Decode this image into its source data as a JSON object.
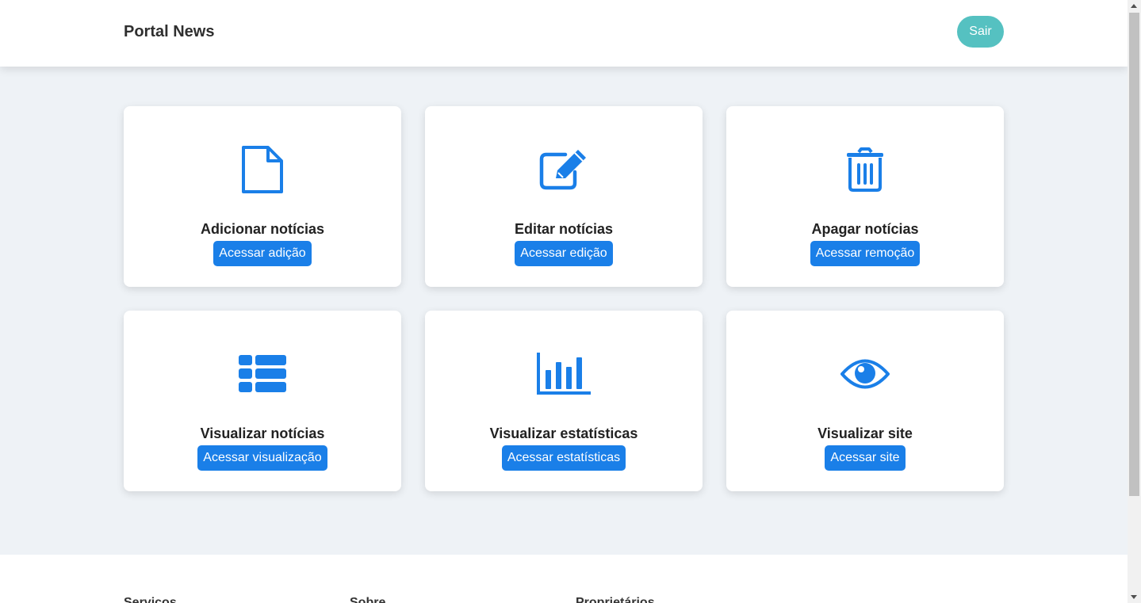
{
  "header": {
    "brand": "Portal News",
    "logout_label": "Sair"
  },
  "cards": [
    {
      "title": "Adicionar notícias",
      "button": "Acessar adição",
      "icon": "file-icon"
    },
    {
      "title": "Editar notícias",
      "button": "Acessar edição",
      "icon": "edit-icon"
    },
    {
      "title": "Apagar notícias",
      "button": "Acessar remoção",
      "icon": "trash-icon"
    },
    {
      "title": "Visualizar notícias",
      "button": "Acessar visualização",
      "icon": "list-icon"
    },
    {
      "title": "Visualizar estatísticas",
      "button": "Acessar estatísticas",
      "icon": "bar-chart-icon"
    },
    {
      "title": "Visualizar site",
      "button": "Acessar site",
      "icon": "eye-icon"
    }
  ],
  "footer": {
    "columns": [
      "Serviços",
      "Sobre",
      "Proprietários"
    ]
  },
  "colors": {
    "accent": "#1a7fe8",
    "logout": "#55c1c1",
    "background": "#eef2f6"
  }
}
